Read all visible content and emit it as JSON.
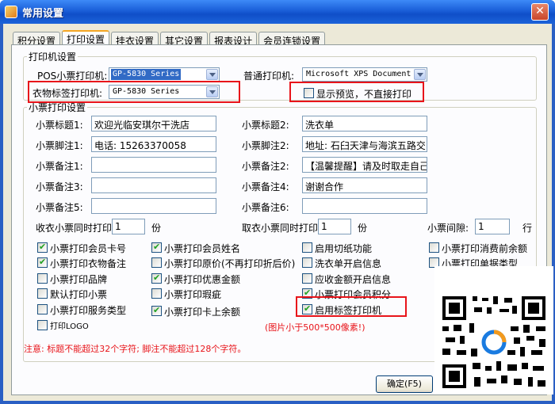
{
  "window": {
    "title": "常用设置",
    "close": "✕"
  },
  "tabs": [
    "积分设置",
    "打印设置",
    "挂衣设置",
    "其它设置",
    "报表设计",
    "会员连锁设置"
  ],
  "printer_settings": {
    "legend": "打印机设置",
    "pos_label": "POS小票打印机:",
    "pos_value": "GP-5830 Series",
    "normal_label": "普通打印机:",
    "normal_value": "Microsoft XPS Document",
    "label_printer_label": "衣物标签打印机:",
    "label_printer_value": "GP-5830 Series",
    "preview_label": "显示预览，不直接打印",
    "preview_checked": false
  },
  "receipt": {
    "legend": "小票打印设置",
    "title1_label": "小票标题1:",
    "title1": "欢迎光临安琪尔干洗店",
    "title2_label": "小票标题2:",
    "title2": "洗衣单",
    "footer1_label": "小票脚注1:",
    "footer1": "电话: 15263370058",
    "footer2_label": "小票脚注2:",
    "footer2": "地址: 石臼天津与海滨五路交",
    "remark1_label": "小票备注1:",
    "remark1": "",
    "remark2_label": "小票备注2:",
    "remark2": "【温馨提醒】请及时取走自己",
    "remark3_label": "小票备注3:",
    "remark3": "",
    "remark4_label": "小票备注4:",
    "remark4": "谢谢合作",
    "remark5_label": "小票备注5:",
    "remark5": "",
    "remark6_label": "小票备注6:",
    "remark6": "",
    "collect_label": "收衣小票同时打印",
    "collect_value": "1",
    "collect_unit": "份",
    "pickup_label": "取衣小票同时打印",
    "pickup_value": "1",
    "pickup_unit": "份",
    "gap_label": "小票间隙:",
    "gap_value": "1",
    "gap_unit": "行"
  },
  "options": [
    {
      "label": "小票打印会员卡号",
      "checked": true
    },
    {
      "label": "小票打印会员姓名",
      "checked": true
    },
    {
      "label": "启用切纸功能",
      "checked": false
    },
    {
      "label": "小票打印消费前余额",
      "checked": false
    },
    {
      "label": "小票打印衣物备注",
      "checked": true
    },
    {
      "label": "小票打印原价(不再打印折后价)",
      "checked": false
    },
    {
      "label": "洗衣单开启信息",
      "checked": false
    },
    {
      "label": "小票打印单据类型",
      "checked": false
    },
    {
      "label": "小票打印品牌",
      "checked": false
    },
    {
      "label": "小票打印优惠金额",
      "checked": true
    },
    {
      "label": "应收金额开启信息",
      "checked": false
    },
    {
      "label": "默认打印小票",
      "checked": false
    },
    {
      "label": "小票打印瑕疵",
      "checked": false
    },
    {
      "label": "小票打印会员积分",
      "checked": true
    },
    {
      "label": "小票打印服务类型",
      "checked": false
    },
    {
      "label": "小票打印卡上余额",
      "checked": true
    },
    {
      "label": "启用标签打印机",
      "checked": true
    },
    {
      "label": "打印LOGO",
      "checked": false
    }
  ],
  "image_note": "(图片小于500*500像素!)",
  "note": "注意: 标题不能超过32个字符; 脚注不能超过128个字符。",
  "ok_button": "确定(F5)",
  "colors": {
    "accent_red": "#e8141a",
    "title_blue": "#0f4ec8"
  }
}
